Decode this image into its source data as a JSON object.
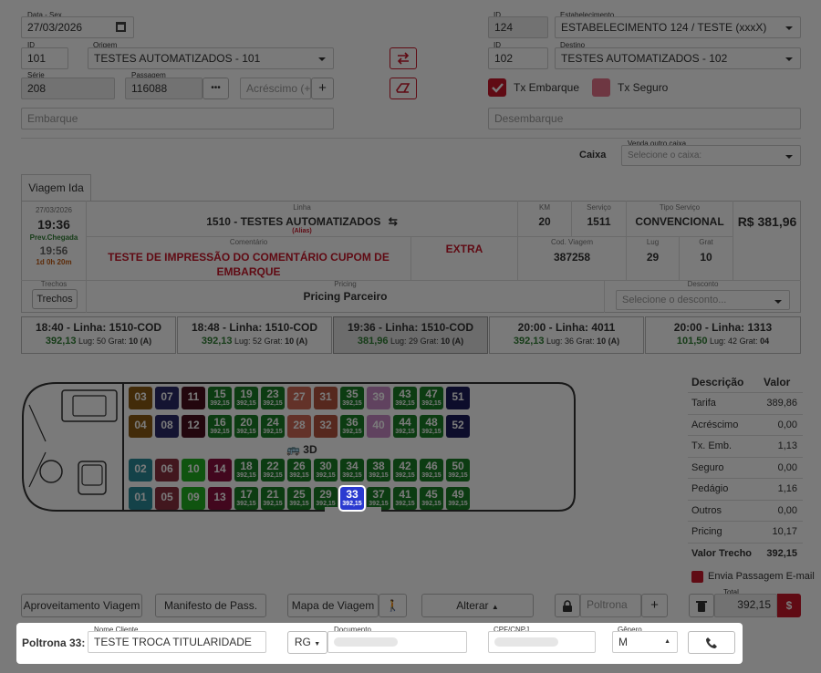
{
  "form": {
    "data_label": "Data - Sex",
    "data_value": "27/03/2026",
    "id1_label": "ID",
    "id1_value": "124",
    "estab_label": "Estabelecimento",
    "estab_value": "ESTABELECIMENTO 124 / TESTE (xxxX)",
    "origem_id_label": "ID",
    "origem_id_value": "101",
    "origem_label": "Origem",
    "origem_value": "TESTES AUTOMATIZADOS - 101",
    "destino_id_label": "ID",
    "destino_id_value": "102",
    "destino_label": "Destino",
    "destino_value": "TESTES AUTOMATIZADOS - 102",
    "serie_label": "Série",
    "serie_value": "208",
    "passagem_label": "Passagem",
    "passagem_value": "116088",
    "passagem_more": "•••",
    "acrescimo_placeholder": "Acréscimo (+)",
    "plus": "+",
    "tx_embarque": "Tx Embarque",
    "tx_seguro": "Tx Seguro",
    "embarque_placeholder": "Embarque",
    "desembarque_placeholder": "Desembarque",
    "caixa_label": "Caixa",
    "venda_label": "Venda outro caixa",
    "venda_placeholder": "Selecione o caixa:"
  },
  "tab": {
    "label": "Viagem Ida"
  },
  "trip_detail": {
    "date": "27/03/2026",
    "time": "19:36",
    "prev_label": "Prev.Chegada",
    "prev_time": "19:56",
    "duration": "1d 0h 20m",
    "linha_label": "Linha",
    "linha_value": "1510 - TESTES AUTOMATIZADOS",
    "alias": "(Alias)",
    "km_label": "KM",
    "km_value": "20",
    "servico_label": "Serviço",
    "servico_value": "1511",
    "tipo_label": "Tipo Serviço",
    "tipo_value": "CONVENCIONAL",
    "price": "R$ 381,96",
    "comentario_label": "Comentário",
    "comentario_value": "TESTE DE IMPRESSÃO DO COMENTÁRIO CUPOM DE EMBARQUE",
    "extra": "EXTRA",
    "cod_label": "Cod. Viagem",
    "cod_value": "387258",
    "lug_label": "Lug",
    "lug_value": "29",
    "grat_label": "Grat",
    "grat_value": "10",
    "trechos_label": "Trechos",
    "trechos_button": "Trechos",
    "pricing_label": "Pricing",
    "pricing_value": "Pricing Parceiro",
    "desconto_label": "Desconto",
    "desconto_placeholder": "Selecione o desconto..."
  },
  "trips": [
    {
      "title": "18:40 - Linha: 1510-COD",
      "price": "392,13",
      "lug": "Lug: 50",
      "grat_prefix": "Grat:",
      "grat": "10 (A)"
    },
    {
      "title": "18:48 - Linha: 1510-COD",
      "price": "392,13",
      "lug": "Lug: 52",
      "grat_prefix": "Grat:",
      "grat": "10 (A)"
    },
    {
      "title": "19:36 - Linha: 1510-COD",
      "price": "381,96",
      "lug": "Lug: 29",
      "grat_prefix": "Grat:",
      "grat": "10 (A)"
    },
    {
      "title": "20:00 - Linha: 4011",
      "price": "392,13",
      "lug": "Lug: 36",
      "grat_prefix": "Grat:",
      "grat": "10 (A)"
    },
    {
      "title": "20:00 - Linha: 1313",
      "price": "101,50",
      "lug": "Lug: 42",
      "grat_prefix": "Grat:",
      "grat": "04"
    }
  ],
  "bus": {
    "label_3d": "3D"
  },
  "seats": {
    "row1": [
      {
        "n": "03",
        "p": "",
        "c": "#8a5a14"
      },
      {
        "n": "07",
        "p": "",
        "c": "#2a2a6a"
      },
      {
        "n": "11",
        "p": "",
        "c": "#4a0f1e"
      },
      {
        "n": "15",
        "p": "392,15",
        "c": "#1b7d26"
      },
      {
        "n": "19",
        "p": "392,15",
        "c": "#1b7d26"
      },
      {
        "n": "23",
        "p": "392,15",
        "c": "#1b7d26"
      },
      {
        "n": "27",
        "p": "",
        "c": "#cf6a56"
      },
      {
        "n": "31",
        "p": "",
        "c": "#b5553f"
      },
      {
        "n": "35",
        "p": "392,15",
        "c": "#1b7d26"
      },
      {
        "n": "39",
        "p": "",
        "c": "#c98ac7"
      },
      {
        "n": "43",
        "p": "392,15",
        "c": "#1b7d26"
      },
      {
        "n": "47",
        "p": "392,15",
        "c": "#1b7d26"
      },
      {
        "n": "51",
        "p": "",
        "c": "#1c1c5a"
      }
    ],
    "row2": [
      {
        "n": "04",
        "p": "",
        "c": "#8a5a14"
      },
      {
        "n": "08",
        "p": "",
        "c": "#2a2a6a"
      },
      {
        "n": "12",
        "p": "",
        "c": "#4a0f1e"
      },
      {
        "n": "16",
        "p": "392,15",
        "c": "#1b7d26"
      },
      {
        "n": "20",
        "p": "392,15",
        "c": "#1b7d26"
      },
      {
        "n": "24",
        "p": "392,15",
        "c": "#1b7d26"
      },
      {
        "n": "28",
        "p": "",
        "c": "#cf6a56"
      },
      {
        "n": "32",
        "p": "",
        "c": "#b5553f"
      },
      {
        "n": "36",
        "p": "392,15",
        "c": "#1b7d26"
      },
      {
        "n": "40",
        "p": "",
        "c": "#c98ac7"
      },
      {
        "n": "44",
        "p": "392,15",
        "c": "#1b7d26"
      },
      {
        "n": "48",
        "p": "392,15",
        "c": "#1b7d26"
      },
      {
        "n": "52",
        "p": "",
        "c": "#1c1c5a"
      }
    ],
    "row3": [
      {
        "n": "02",
        "p": "",
        "c": "#2a8a9a"
      },
      {
        "n": "06",
        "p": "",
        "c": "#8a3040"
      },
      {
        "n": "10",
        "p": "",
        "c": "#22b022"
      },
      {
        "n": "14",
        "p": "",
        "c": "#8a1040"
      },
      {
        "n": "18",
        "p": "392,15",
        "c": "#1b7d26"
      },
      {
        "n": "22",
        "p": "392,15",
        "c": "#1b7d26"
      },
      {
        "n": "26",
        "p": "392,15",
        "c": "#1b7d26"
      },
      {
        "n": "30",
        "p": "392,15",
        "c": "#1b7d26"
      },
      {
        "n": "34",
        "p": "392,15",
        "c": "#1b7d26"
      },
      {
        "n": "38",
        "p": "392,15",
        "c": "#1b7d26"
      },
      {
        "n": "42",
        "p": "392,15",
        "c": "#1b7d26"
      },
      {
        "n": "46",
        "p": "392,15",
        "c": "#1b7d26"
      },
      {
        "n": "50",
        "p": "392,15",
        "c": "#1b7d26"
      }
    ],
    "row4": [
      {
        "n": "01",
        "p": "",
        "c": "#2a8a9a"
      },
      {
        "n": "05",
        "p": "",
        "c": "#8a3040"
      },
      {
        "n": "09",
        "p": "",
        "c": "#22b022"
      },
      {
        "n": "13",
        "p": "",
        "c": "#8a1040"
      },
      {
        "n": "17",
        "p": "392,15",
        "c": "#1b7d26"
      },
      {
        "n": "21",
        "p": "392,15",
        "c": "#1b7d26"
      },
      {
        "n": "25",
        "p": "392,15",
        "c": "#1b7d26"
      },
      {
        "n": "29",
        "p": "392,15",
        "c": "#1b7d26"
      },
      {
        "n": "33",
        "p": "392,15",
        "c": "#2a3ad0"
      },
      {
        "n": "37",
        "p": "392,15",
        "c": "#1b7d26"
      },
      {
        "n": "41",
        "p": "392,15",
        "c": "#1b7d26"
      },
      {
        "n": "45",
        "p": "392,15",
        "c": "#1b7d26"
      },
      {
        "n": "49",
        "p": "392,15",
        "c": "#1b7d26"
      }
    ]
  },
  "summary": {
    "h_desc": "Descrição",
    "h_val": "Valor",
    "rows": [
      {
        "k": "Tarifa",
        "v": "389,86"
      },
      {
        "k": "Acréscimo",
        "v": "0,00"
      },
      {
        "k": "Tx. Emb.",
        "v": "1,13"
      },
      {
        "k": "Seguro",
        "v": "0,00"
      },
      {
        "k": "Pedágio",
        "v": "1,16"
      },
      {
        "k": "Outros",
        "v": "0,00"
      },
      {
        "k": "Pricing",
        "v": "10,17"
      },
      {
        "k": "Valor Trecho",
        "v": "392,15"
      }
    ],
    "envia": "Envia Passagem E-mail",
    "total_label": "Total",
    "total_value": "392,15",
    "currency": "$"
  },
  "actions": {
    "aproveitamento": "Aproveitamento Viagem",
    "manifesto": "Manifesto de Pass.",
    "mapa": "Mapa de Viagem",
    "alterar": "Alterar",
    "poltrona_placeholder": "Poltrona",
    "plus": "+"
  },
  "passenger": {
    "poltrona_label": "Poltrona 33:",
    "nome_label": "Nome Cliente",
    "nome_value": "TESTE TROCA TITULARIDADE",
    "doc_type": "RG",
    "documento_label": "Documento",
    "cpf_label": "CPF/CNPJ",
    "genero_label": "Gênero",
    "genero_value": "M"
  },
  "colors": {
    "accent_red": "#c9182b",
    "green": "#2e7d32",
    "selected_blue": "#2a3ad0"
  }
}
